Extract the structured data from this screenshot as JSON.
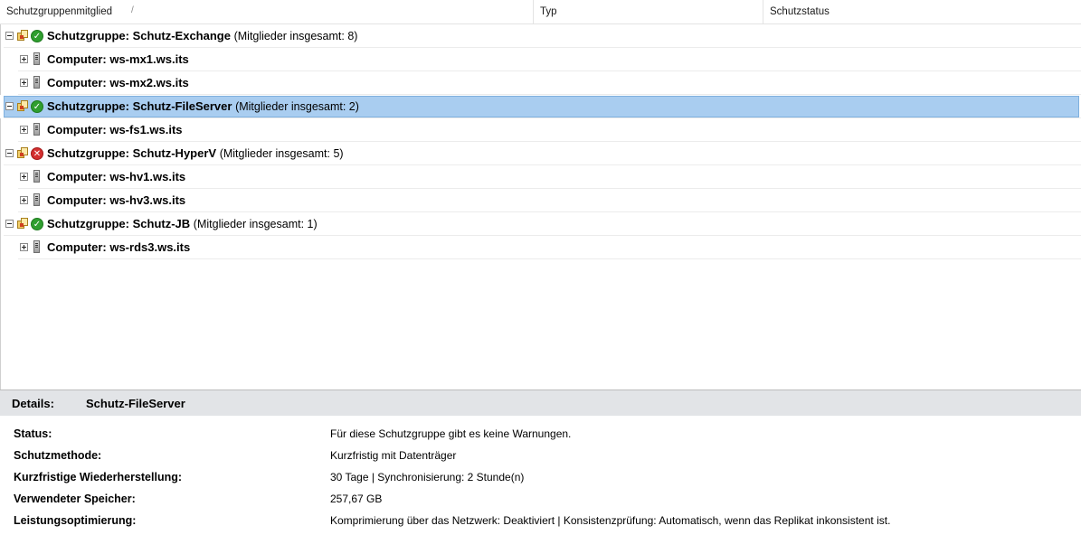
{
  "columns": {
    "member": "Schutzgruppenmitglied",
    "type": "Typ",
    "status": "Schutzstatus"
  },
  "groups": [
    {
      "prefix": "Schutzgruppe: ",
      "name": "Schutz-Exchange",
      "count_text": "(Mitglieder insgesamt: 8)",
      "status_icon": "check-icon",
      "status_color": "#2f9e2f",
      "members": [
        {
          "prefix": "Computer: ",
          "name": "ws-mx1.ws.its"
        },
        {
          "prefix": "Computer: ",
          "name": "ws-mx2.ws.its"
        }
      ]
    },
    {
      "prefix": "Schutzgruppe: ",
      "name": "Schutz-FileServer",
      "count_text": "(Mitglieder insgesamt: 2)",
      "status_icon": "check-icon",
      "status_color": "#2f9e2f",
      "selected": true,
      "members": [
        {
          "prefix": "Computer: ",
          "name": "ws-fs1.ws.its"
        }
      ]
    },
    {
      "prefix": "Schutzgruppe: ",
      "name": "Schutz-HyperV",
      "count_text": "(Mitglieder insgesamt: 5)",
      "status_icon": "error-icon",
      "status_color": "#d33030",
      "members": [
        {
          "prefix": "Computer: ",
          "name": "ws-hv1.ws.its"
        },
        {
          "prefix": "Computer: ",
          "name": "ws-hv3.ws.its"
        }
      ]
    },
    {
      "prefix": "Schutzgruppe: ",
      "name": "Schutz-JB",
      "count_text": "(Mitglieder insgesamt: 1)",
      "status_icon": "check-icon",
      "status_color": "#2f9e2f",
      "members": [
        {
          "prefix": "Computer: ",
          "name": "ws-rds3.ws.its"
        }
      ]
    }
  ],
  "details": {
    "label": "Details:",
    "title": "Schutz-FileServer",
    "rows": [
      {
        "key": "Status:",
        "value": "Für diese Schutzgruppe gibt es keine Warnungen."
      },
      {
        "key": "Schutzmethode:",
        "value": "Kurzfristig mit Datenträger"
      },
      {
        "key": "Kurzfristige Wiederherstellung:",
        "value": "30 Tage | Synchronisierung: 2 Stunde(n)"
      },
      {
        "key": "Verwendeter Speicher:",
        "value": "257,67 GB"
      },
      {
        "key": "Leistungsoptimierung:",
        "value": "Komprimierung über das Netzwerk: Deaktiviert | Konsistenzprüfung: Automatisch, wenn das Replikat inkonsistent ist."
      }
    ]
  },
  "colors": {
    "selection": "#a9cdf0",
    "details_header": "#e2e4e7"
  }
}
